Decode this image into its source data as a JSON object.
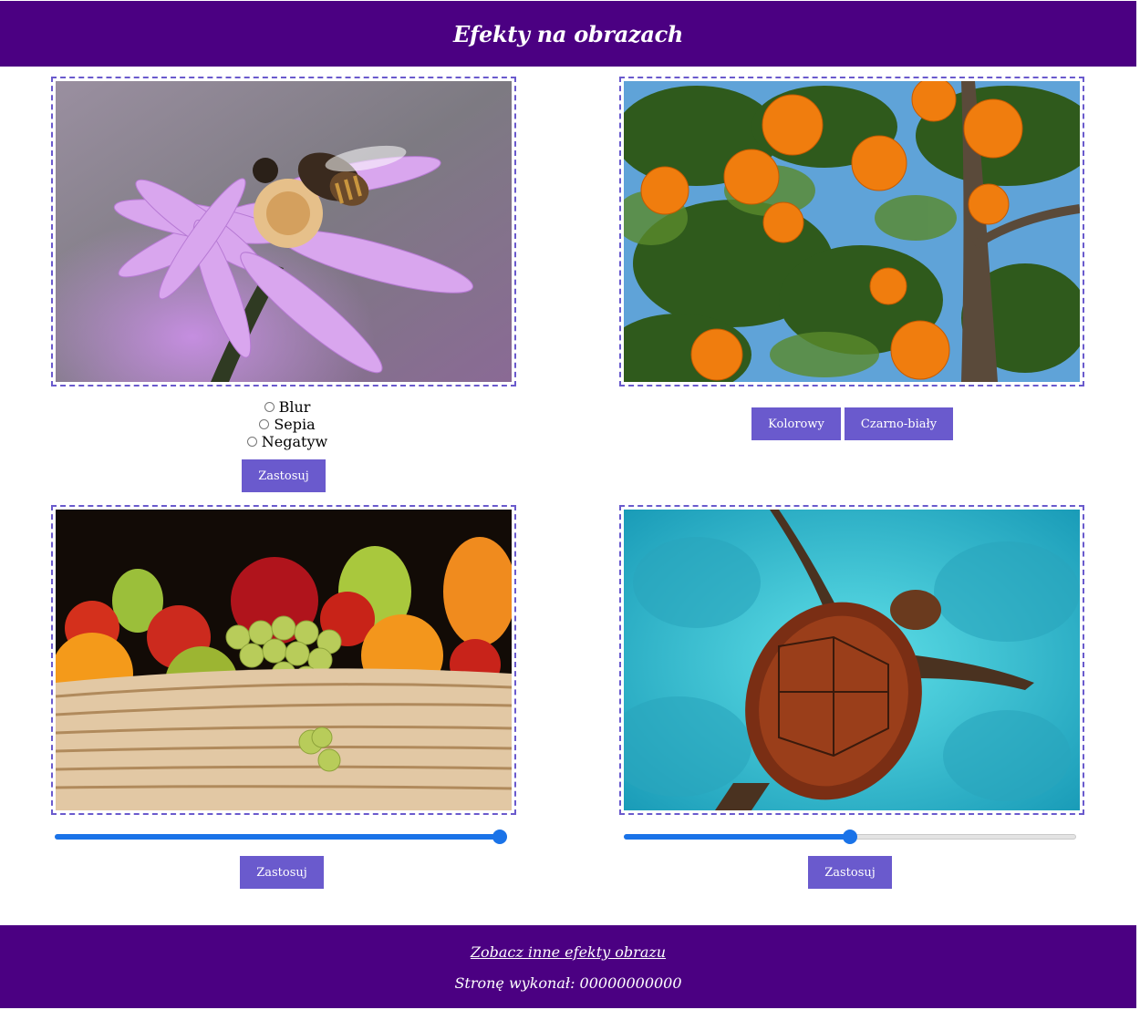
{
  "header": {
    "title": "Efekty na obrazach"
  },
  "gallery": {
    "image_1": {
      "effects": [
        "Blur",
        "Sepia",
        "Negatyw"
      ],
      "apply_label": "Zastosuj"
    },
    "image_2": {
      "color_label": "Kolorowy",
      "bw_label": "Czarno-biały"
    },
    "image_3": {
      "slider_value_percent": 100,
      "apply_label": "Zastosuj"
    },
    "image_4": {
      "slider_value_percent": 50,
      "apply_label": "Zastosuj"
    }
  },
  "footer": {
    "link_label": "Zobacz inne efekty obrazu",
    "author": "Stronę wykonał: 00000000000"
  },
  "colors": {
    "header_bg": "#4b0082",
    "accent": "#6a5acd",
    "slider": "#1a73e8"
  }
}
